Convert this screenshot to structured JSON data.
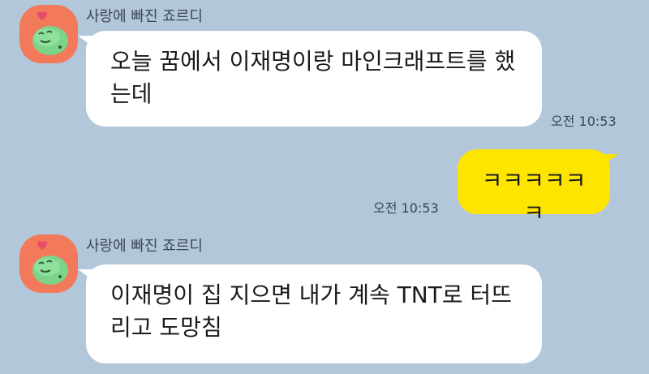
{
  "messages": [
    {
      "sender": "사랑에 빠진 죠르디",
      "text_line1": "오늘 꿈에서 이재명이랑 마인크래프트를 했",
      "text_line2": "는데",
      "time": "오전 10:53"
    },
    {
      "text": "ㅋㅋㅋㅋㅋㅋ",
      "time": "오전 10:53"
    },
    {
      "sender": "사랑에 빠진 죠르디",
      "text_line1": "이재명이 집 지으면 내가 계속 TNT로 터뜨",
      "text_line2": "리고 도망침"
    }
  ],
  "colors": {
    "background": "#b2c7da",
    "incoming_bubble": "#ffffff",
    "outgoing_bubble": "#fee500",
    "avatar_bg": "#f27a5a"
  },
  "avatar_icon": "jordy-dinosaur-icon"
}
